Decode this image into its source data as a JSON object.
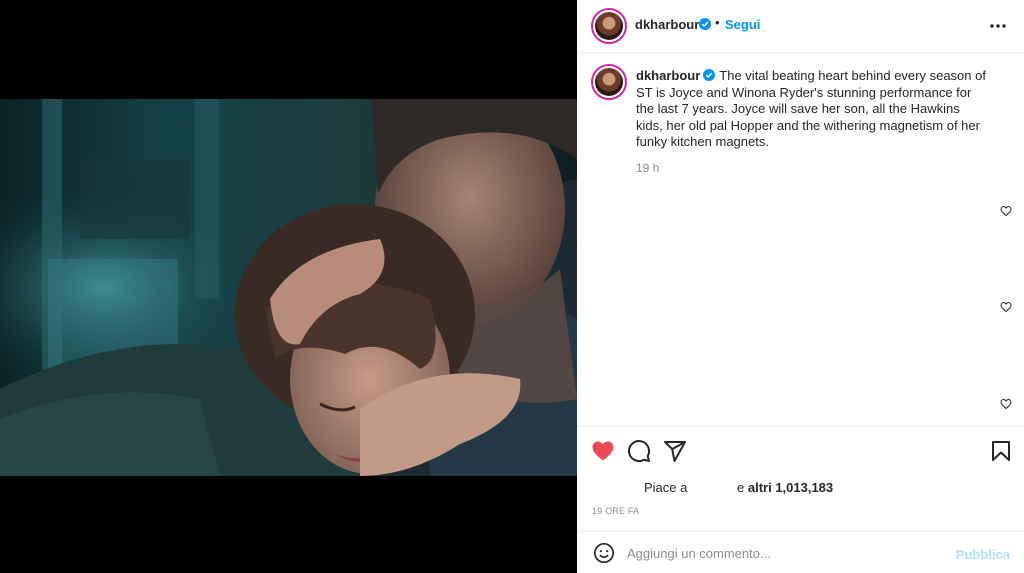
{
  "post": {
    "username": "dkharbour",
    "separator": "•",
    "follow_label": "Segui",
    "verified": true,
    "icons": {
      "more": "more-horizontal-icon",
      "verified": "verified-badge-icon"
    }
  },
  "caption": {
    "username": "dkharbour",
    "text": "The vital beating heart behind every season of ST is Joyce and Winona Ryder's stunning performance for the last 7 years. Joyce will save her son, all the Hawkins kids, her old pal Hopper and the withering magnetism of her funky kitchen magnets.",
    "time": "19 h"
  },
  "actions": {
    "like": "heart-filled-icon",
    "comment": "comment-icon",
    "share": "share-icon",
    "save": "bookmark-icon",
    "like_color": "#ed4956"
  },
  "likes": {
    "prefix": "Piace a",
    "suffix_plain": "e",
    "suffix_bold": "altri 1,013,183"
  },
  "timestamp": "19 ORE FA",
  "comment_box": {
    "placeholder": "Aggiungi un commento...",
    "publish_label": "Pubblica"
  },
  "colors": {
    "accent": "#0095f6",
    "publish_disabled": "#b2dffc",
    "secondary_text": "#8e8e8e"
  }
}
